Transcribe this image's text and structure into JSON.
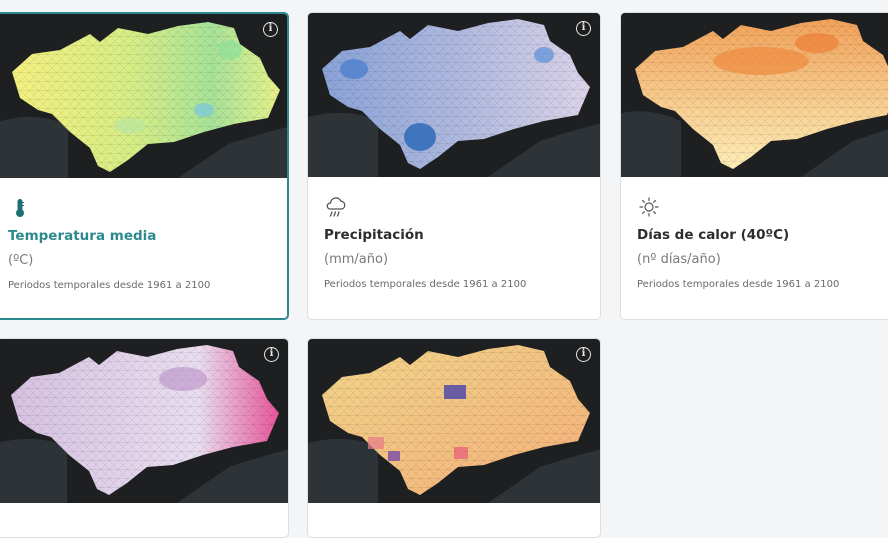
{
  "cards": [
    {
      "title": "Temperatura media",
      "unit": "(ºC)",
      "period": "Periodos temporales desde 1961 a 2100",
      "icon": "thermometer-icon",
      "active": true
    },
    {
      "title": "Precipitación",
      "unit": "(mm/año)",
      "period": "Periodos temporales desde 1961 a 2100",
      "icon": "rain-cloud-icon",
      "active": false
    },
    {
      "title": "Días de calor (40ºC)",
      "unit": "(nº días/año)",
      "period": "Periodos temporales desde 1961 a 2100",
      "icon": "sun-icon",
      "active": false
    },
    {
      "title": "",
      "unit": "",
      "period": "",
      "icon": "",
      "active": false
    },
    {
      "title": "",
      "unit": "",
      "period": "",
      "icon": "",
      "active": false
    }
  ],
  "info_glyph": "i",
  "colors": {
    "accent": "#2c8a8e",
    "map_background": "#1d1f21",
    "sea": "#2e3338"
  }
}
